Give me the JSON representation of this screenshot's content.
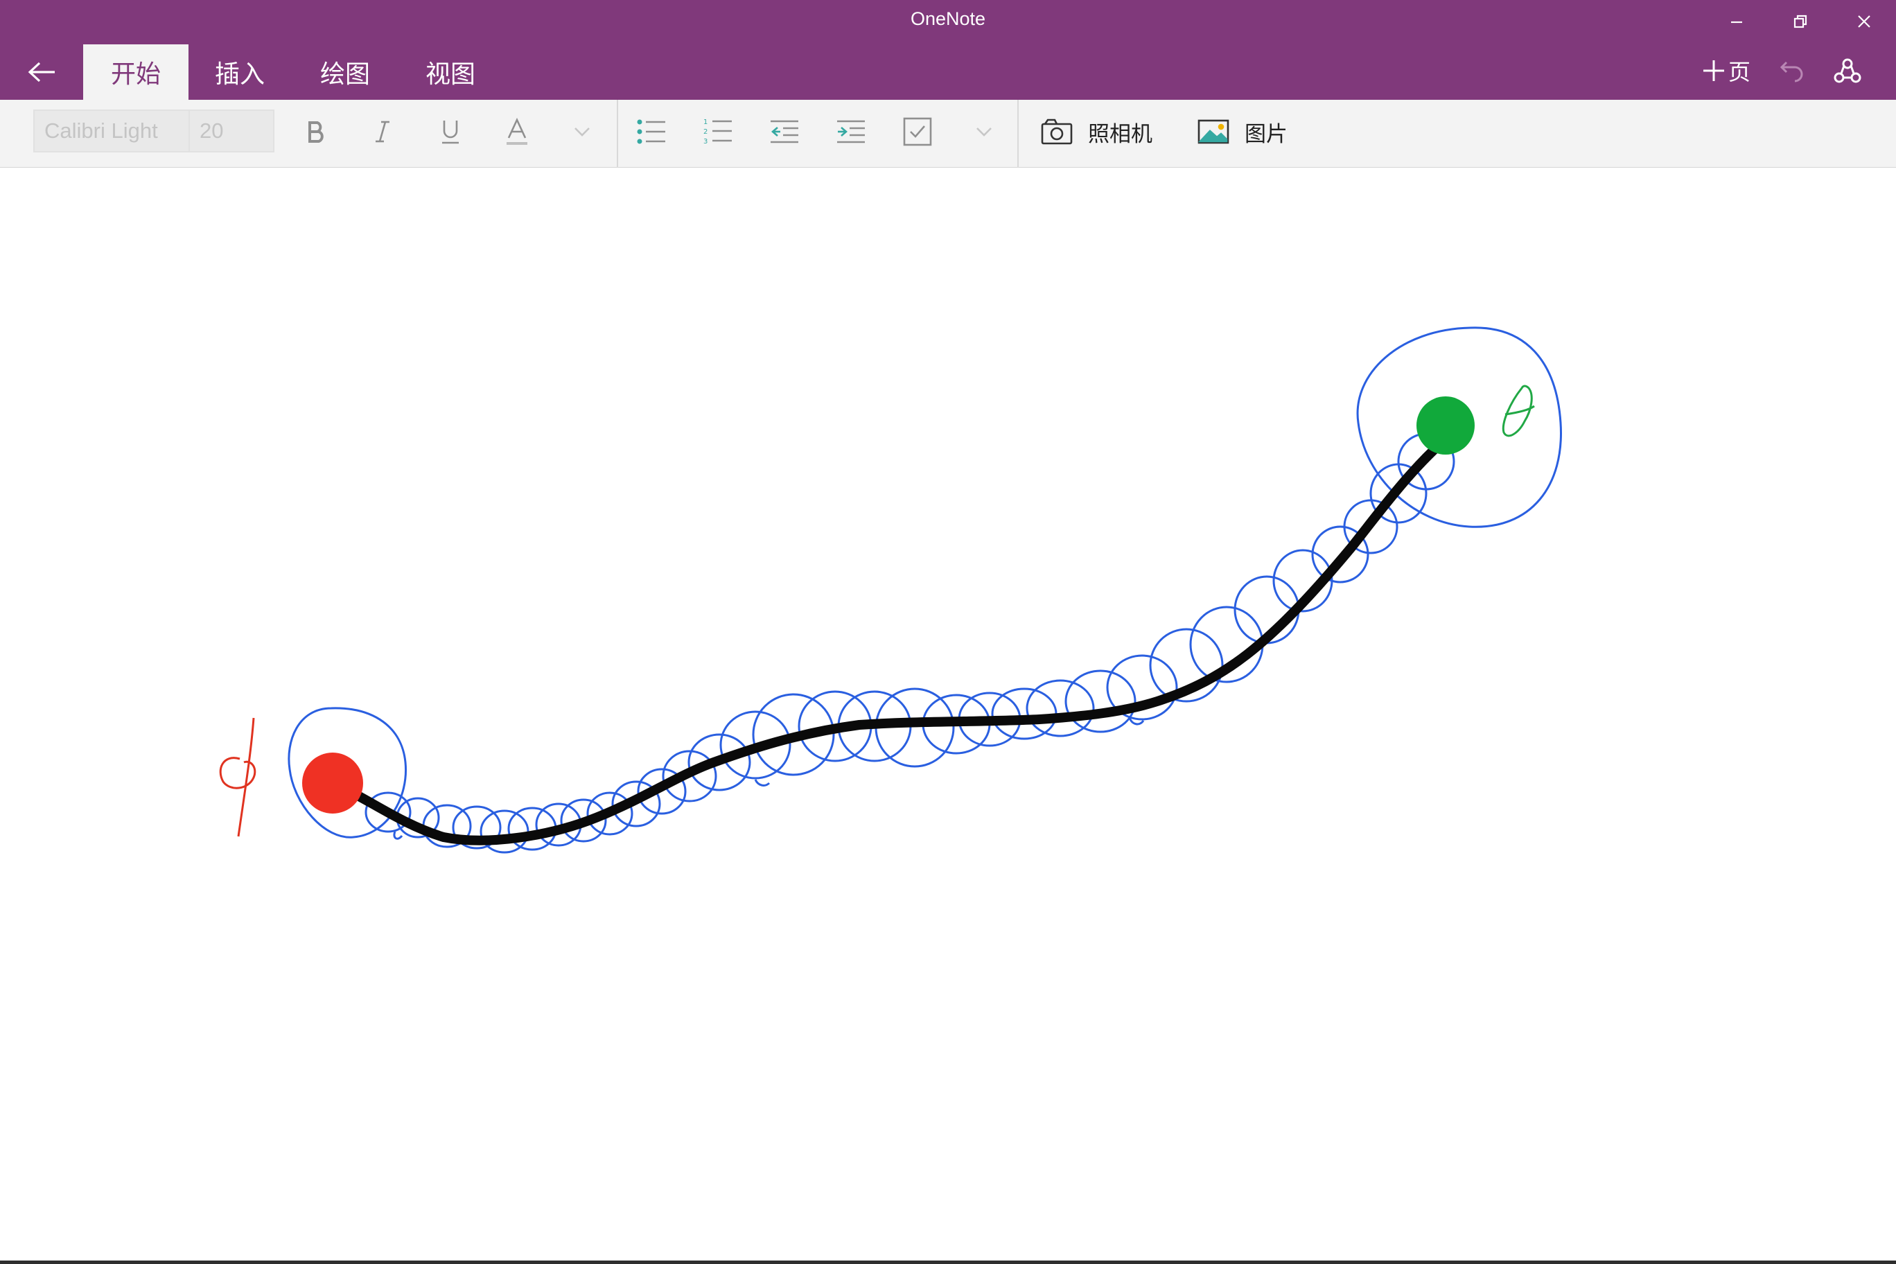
{
  "window": {
    "title": "OneNote"
  },
  "tabs": [
    {
      "label": "开始",
      "active": true
    },
    {
      "label": "插入",
      "active": false
    },
    {
      "label": "绘图",
      "active": false
    },
    {
      "label": "视图",
      "active": false
    }
  ],
  "topbar": {
    "new_page_label": "页",
    "new_page_icon": "plus-icon",
    "undo_icon": "undo-icon",
    "share_icon": "share-icon"
  },
  "ribbon": {
    "font_name": "Calibri Light",
    "font_size": "20",
    "format_icons": [
      "bold-icon",
      "italic-icon",
      "underline-icon",
      "font-color-icon",
      "chevron-down-icon"
    ],
    "list_icons": [
      "bullet-list-icon",
      "numbered-list-icon",
      "outdent-icon",
      "indent-icon",
      "checkbox-icon",
      "chevron-down-icon"
    ],
    "camera_label": "照相机",
    "picture_label": "图片"
  },
  "colors": {
    "title_bar": "#80397b",
    "start_dot": "#ef3124",
    "end_dot": "#11a93b",
    "ink_path": "#0a0a0a",
    "ink_loops": "#2a5fe0",
    "ink_red": "#e03320",
    "ink_green": "#21a845"
  }
}
